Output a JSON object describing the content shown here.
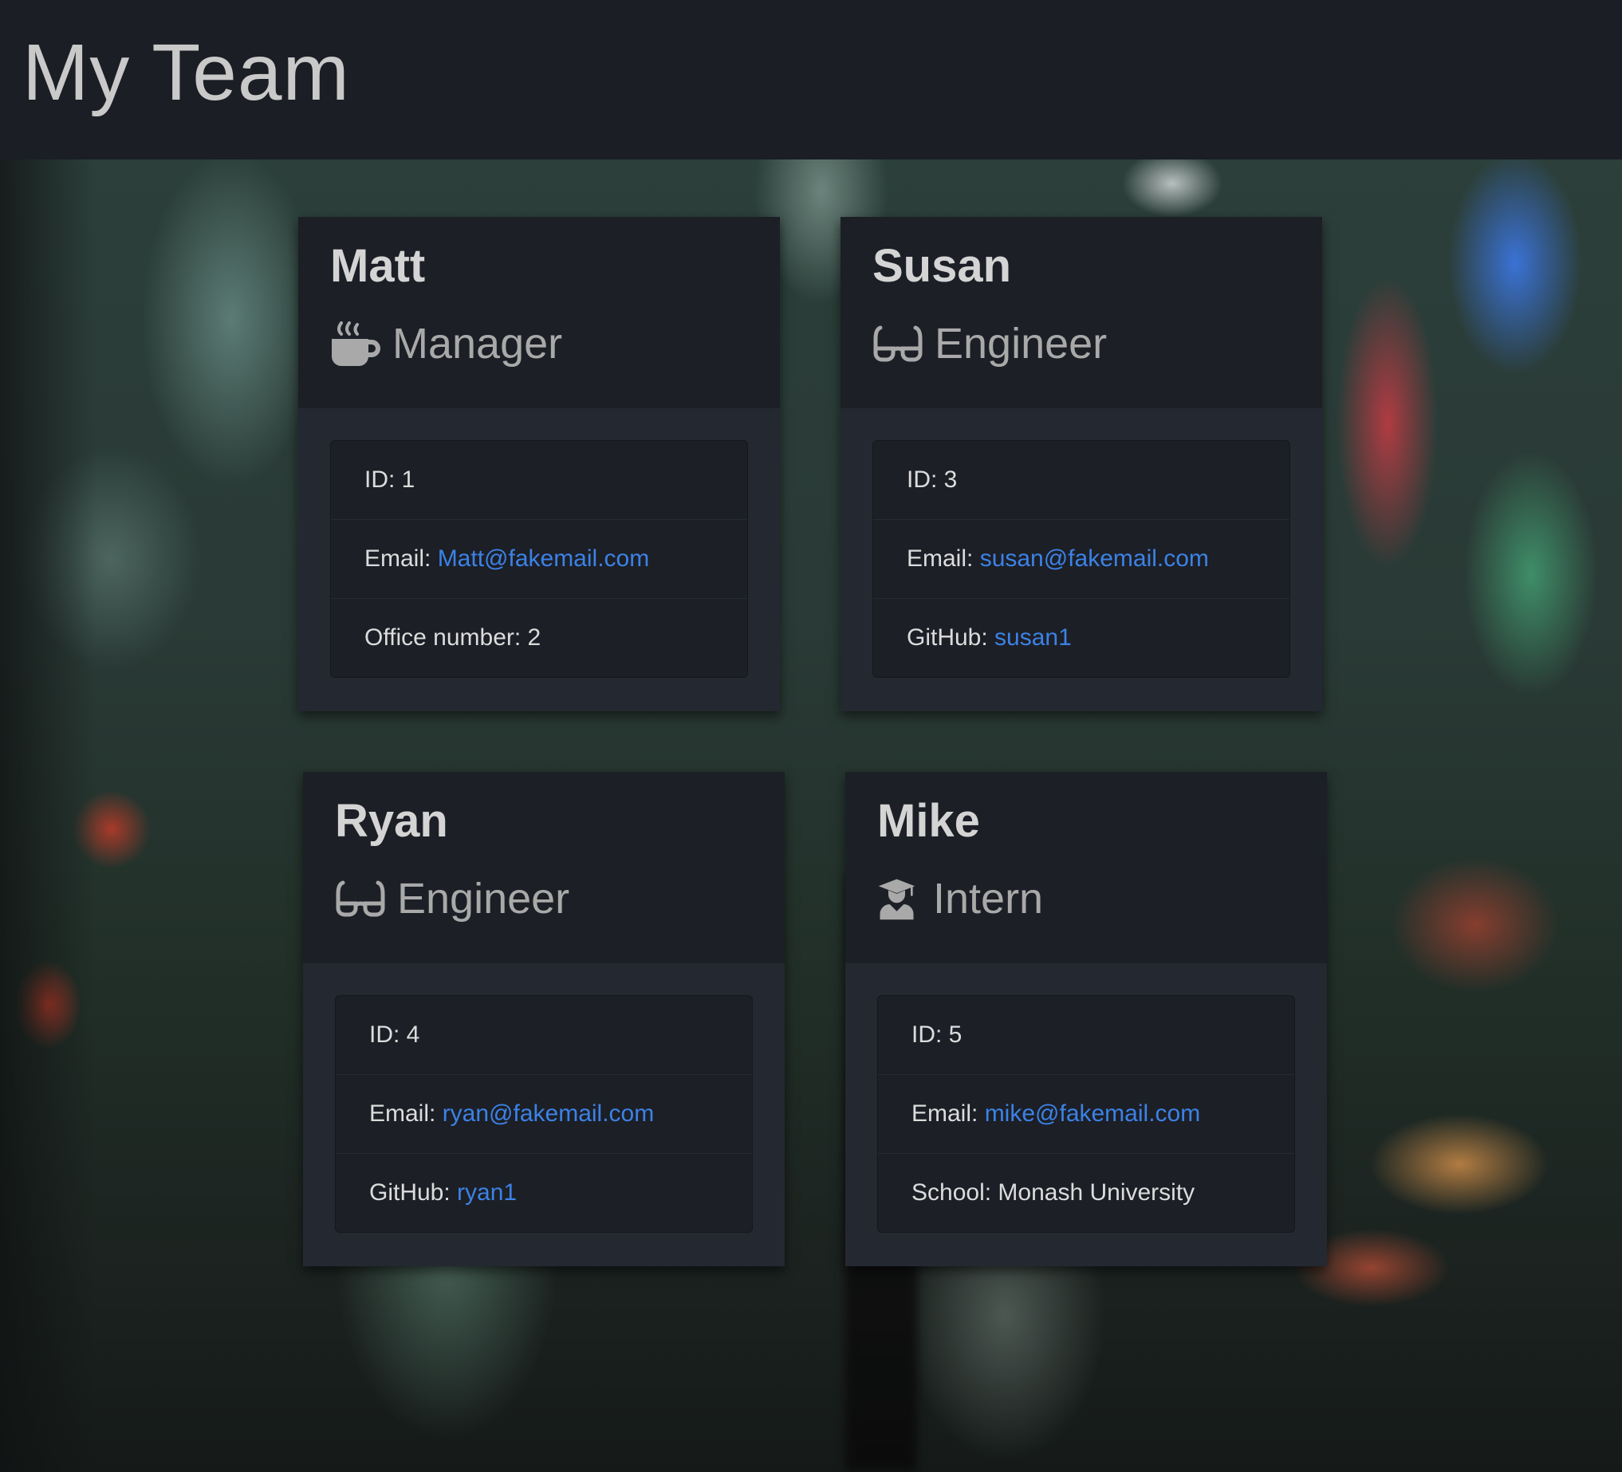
{
  "header": {
    "title": "My Team"
  },
  "colors": {
    "link": "#3c82e6",
    "card_bg": "#242830",
    "card_head_bg": "#1c1f26"
  },
  "cards": [
    {
      "name": "Matt",
      "role": "Manager",
      "role_icon": "mug-hot-icon",
      "id_label": "ID: ",
      "id_value": "1",
      "email_label": "Email: ",
      "email_value": "Matt@fakemail.com",
      "extra_label": "Office number: ",
      "extra_value": "2"
    },
    {
      "name": "Susan",
      "role": "Engineer",
      "role_icon": "glasses-icon",
      "id_label": "ID: ",
      "id_value": "3",
      "email_label": "Email: ",
      "email_value": "susan@fakemail.com",
      "extra_label": "GitHub: ",
      "extra_value": "susan1"
    },
    {
      "name": "Ryan",
      "role": "Engineer",
      "role_icon": "glasses-icon",
      "id_label": "ID: ",
      "id_value": "4",
      "email_label": "Email: ",
      "email_value": "ryan@fakemail.com",
      "extra_label": "GitHub: ",
      "extra_value": "ryan1"
    },
    {
      "name": "Mike",
      "role": "Intern",
      "role_icon": "graduate-icon",
      "id_label": "ID: ",
      "id_value": "5",
      "email_label": "Email: ",
      "email_value": "mike@fakemail.com",
      "extra_label": "School: ",
      "extra_value": "Monash University"
    }
  ]
}
